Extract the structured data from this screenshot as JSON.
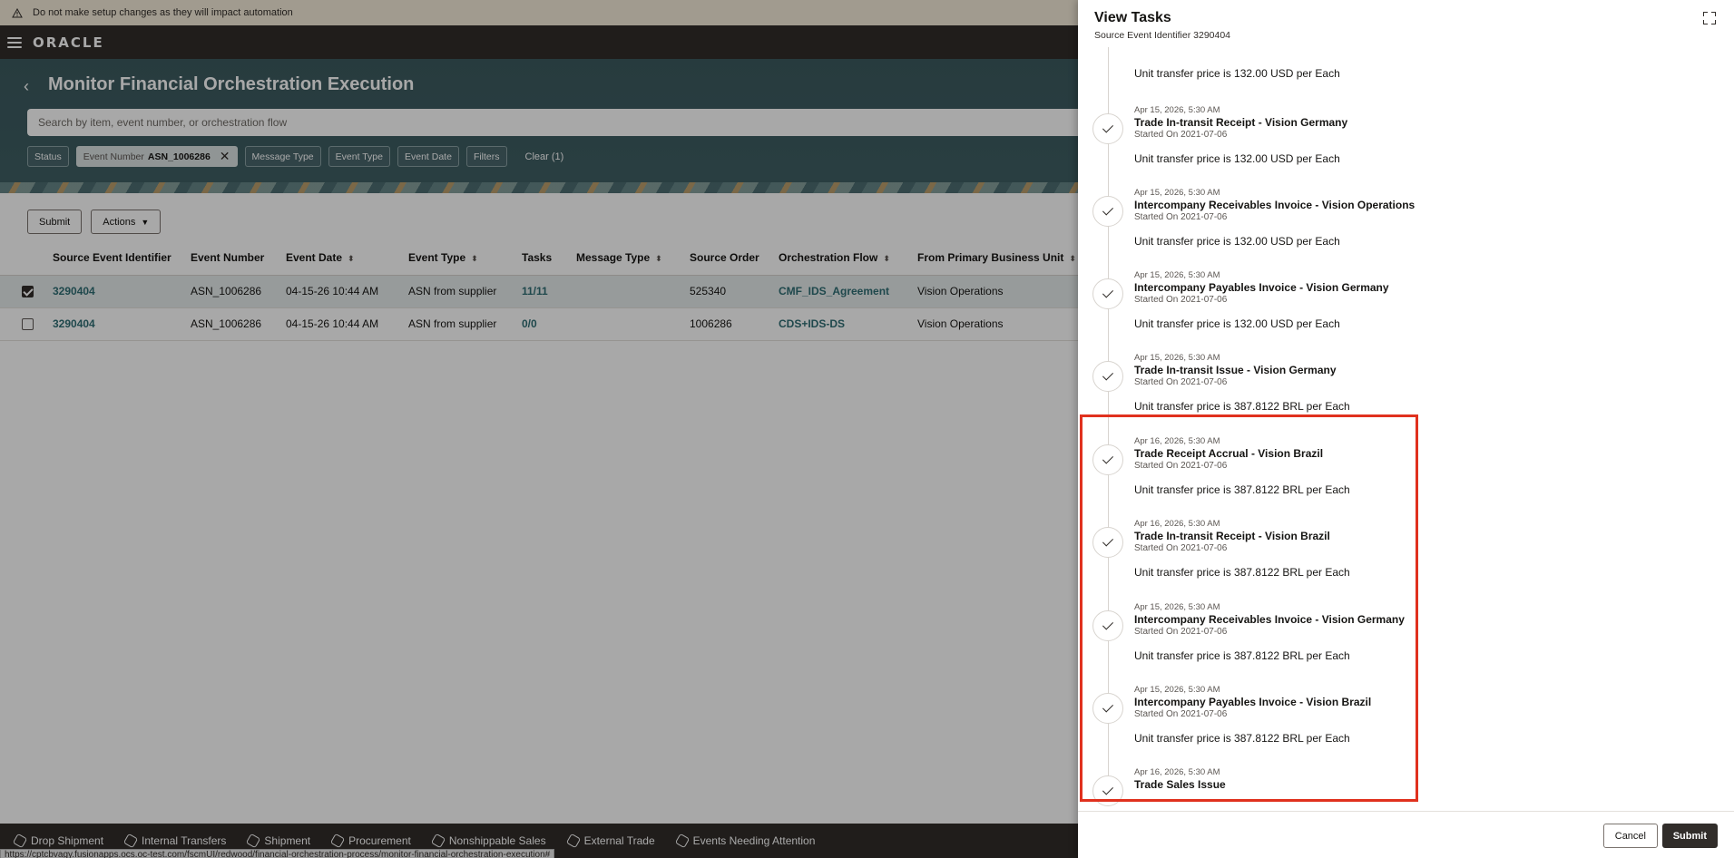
{
  "warning": {
    "text": "Do not make setup changes as they will impact automation",
    "icon": "warning-icon"
  },
  "brand": {
    "logo": "ORACLE"
  },
  "page": {
    "title": "Monitor Financial Orchestration Execution"
  },
  "search": {
    "placeholder": "Search by item, event number, or orchestration flow"
  },
  "filters": {
    "status": "Status",
    "event_number_key": "Event Number",
    "event_number_value": "ASN_1006286",
    "message_type": "Message Type",
    "event_type": "Event Type",
    "event_date": "Event Date",
    "filters": "Filters",
    "clear": "Clear (1)"
  },
  "toolbar": {
    "submit": "Submit",
    "actions": "Actions"
  },
  "table": {
    "columns": [
      "Source Event Identifier",
      "Event Number",
      "Event Date",
      "Event Type",
      "Tasks",
      "Message Type",
      "Source Order",
      "Orchestration Flow",
      "From Primary Business Unit"
    ],
    "rows": [
      {
        "checked": true,
        "source_event_id": "3290404",
        "event_number": "ASN_1006286",
        "event_date": "04-15-26 10:44 AM",
        "event_type": "ASN from supplier",
        "tasks": "11/11",
        "message_type": "",
        "source_order": "525340",
        "flow": "CMF_IDS_Agreement",
        "from_bu": "Vision Operations"
      },
      {
        "checked": false,
        "source_event_id": "3290404",
        "event_number": "ASN_1006286",
        "event_date": "04-15-26 10:44 AM",
        "event_type": "ASN from supplier",
        "tasks": "0/0",
        "message_type": "",
        "source_order": "1006286",
        "flow": "CDS+IDS-DS",
        "from_bu": "Vision Operations"
      }
    ]
  },
  "bottom_tabs": [
    "Drop Shipment",
    "Internal Transfers",
    "Shipment",
    "Procurement",
    "Nonshippable Sales",
    "External Trade",
    "Events Needing Attention"
  ],
  "status_url": "https://cptcbvagy.fusionapps.ocs.oc-test.com/fscmUI/redwood/financial-orchestration-process/monitor-financial-orchestration-execution#",
  "drawer": {
    "title": "View Tasks",
    "subtitle": "Source Event Identifier 3290404",
    "first_price": "Unit transfer price is 132.00 USD per Each",
    "tasks": [
      {
        "date": "Apr 15, 2026, 5:30 AM",
        "title": "Trade In-transit Receipt - Vision Germany",
        "started": "Started On 2021-07-06",
        "price": "Unit transfer price is 132.00 USD per Each"
      },
      {
        "date": "Apr 15, 2026, 5:30 AM",
        "title": "Intercompany Receivables Invoice - Vision Operations",
        "started": "Started On 2021-07-06",
        "price": "Unit transfer price is 132.00 USD per Each"
      },
      {
        "date": "Apr 15, 2026, 5:30 AM",
        "title": "Intercompany Payables Invoice - Vision Germany",
        "started": "Started On 2021-07-06",
        "price": "Unit transfer price is 132.00 USD per Each"
      },
      {
        "date": "Apr 15, 2026, 5:30 AM",
        "title": "Trade In-transit Issue - Vision Germany",
        "started": "Started On 2021-07-06",
        "price": "Unit transfer price is 387.8122 BRL per Each"
      },
      {
        "date": "Apr 16, 2026, 5:30 AM",
        "title": "Trade Receipt Accrual - Vision Brazil",
        "started": "Started On 2021-07-06",
        "price": "Unit transfer price is 387.8122 BRL per Each"
      },
      {
        "date": "Apr 16, 2026, 5:30 AM",
        "title": "Trade In-transit Receipt - Vision Brazil",
        "started": "Started On 2021-07-06",
        "price": "Unit transfer price is 387.8122 BRL per Each"
      },
      {
        "date": "Apr 15, 2026, 5:30 AM",
        "title": "Intercompany Receivables Invoice - Vision Germany",
        "started": "Started On 2021-07-06",
        "price": "Unit transfer price is 387.8122 BRL per Each"
      },
      {
        "date": "Apr 15, 2026, 5:30 AM",
        "title": "Intercompany Payables Invoice - Vision Brazil",
        "started": "Started On 2021-07-06",
        "price": "Unit transfer price is 387.8122 BRL per Each"
      },
      {
        "date": "Apr 16, 2026, 5:30 AM",
        "title": "Trade Sales Issue",
        "started": "",
        "price": ""
      }
    ],
    "cancel": "Cancel",
    "submit": "Submit"
  },
  "colors": {
    "highlight": "#e0311e",
    "header_bg": "#312d2a",
    "hero_bg": "#3f5e63",
    "link": "#2f6e74"
  }
}
